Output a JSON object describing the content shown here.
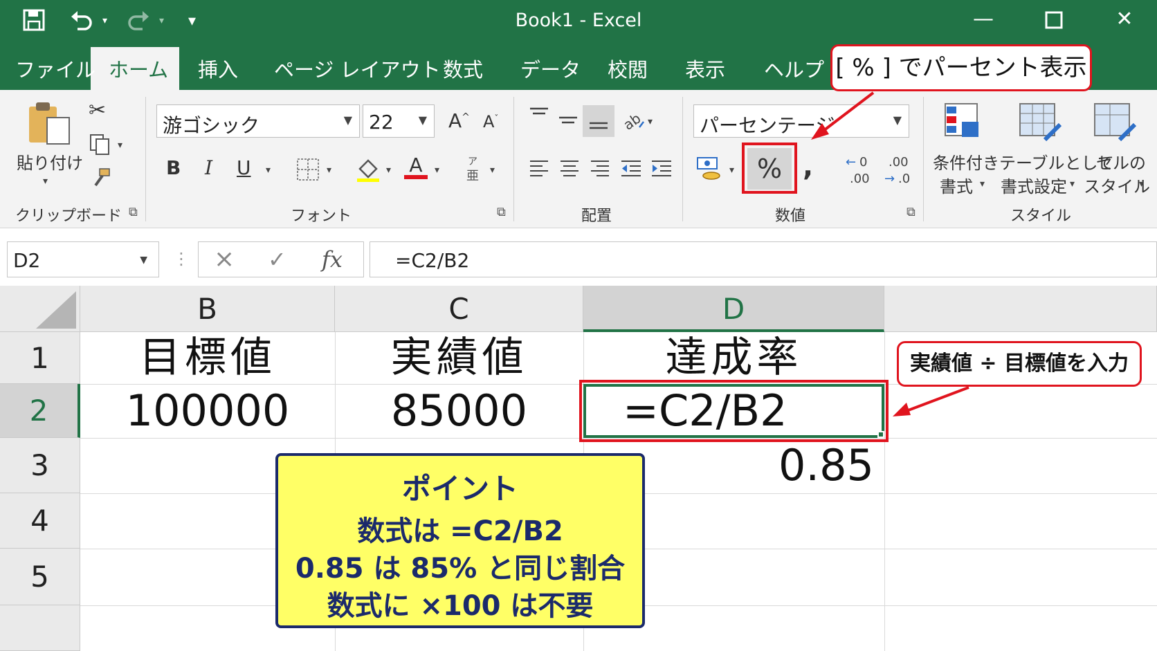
{
  "window": {
    "title": "Book1  -  Excel",
    "minimize_icon": "minimize-icon",
    "maximize_icon": "maximize-icon",
    "close_icon": "close-icon"
  },
  "quick_access": {
    "save_icon": "save-icon",
    "undo_icon": "undo-icon",
    "redo_icon": "redo-icon",
    "customize_icon": "customize-icon"
  },
  "tabs": [
    {
      "label": "ファイル"
    },
    {
      "label": "ホーム"
    },
    {
      "label": "挿入"
    },
    {
      "label": "ページ レイアウト"
    },
    {
      "label": "数式"
    },
    {
      "label": "データ"
    },
    {
      "label": "校閲"
    },
    {
      "label": "表示"
    },
    {
      "label": "ヘルプ"
    }
  ],
  "ribbon": {
    "clipboard": {
      "paste_label": "貼り付け",
      "group_label": "クリップボード"
    },
    "font": {
      "font_name": "游ゴシック",
      "font_size": "22",
      "grow_label": "A",
      "shrink_label": "A",
      "bold_label": "B",
      "italic_label": "I",
      "underline_label": "U",
      "font_color_label": "A",
      "group_label": "フォント"
    },
    "alignment": {
      "group_label": "配置"
    },
    "number": {
      "format": "パーセンテージ",
      "percent_label": "%",
      "comma_label": ",",
      "group_label": "数値"
    },
    "styles": {
      "conditional_line1": "条件付き",
      "conditional_line2": "書式",
      "table_line1": "テーブルとして",
      "table_line2": "書式設定",
      "cell_line1": "セルの",
      "cell_line2": "スタイル",
      "group_label": "スタイル"
    }
  },
  "formula_bar": {
    "name_box": "D2",
    "cancel_icon": "×",
    "enter_icon": "✓",
    "fx_label": "fx",
    "formula": "=C2/B2"
  },
  "sheet": {
    "columns": [
      "B",
      "C",
      "D"
    ],
    "rows": [
      "1",
      "2",
      "3",
      "4",
      "5"
    ],
    "cells": {
      "B1": "目標値",
      "C1": "実績値",
      "D1": "達成率",
      "B2": "100000",
      "C2": "85000",
      "D2": "=C2/B2",
      "D3": "0.85"
    }
  },
  "annotations": {
    "percent_callout": "[ % ] でパーセント表示",
    "input_callout": "実績値 ÷ 目標値を入力",
    "point": {
      "title": "ポイント",
      "line1": "数式は =C2/B2",
      "line2": "0.85 は 85% と同じ割合",
      "line3": "数式に ×100 は不要"
    },
    "accent_color": "#e0141e",
    "point_bg_color": "#ffff66",
    "excel_green": "#217346"
  }
}
